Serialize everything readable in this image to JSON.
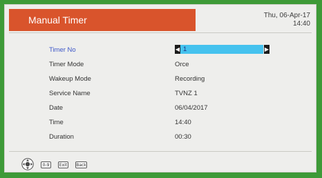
{
  "header": {
    "title": "Manual Timer",
    "date": "Thu, 06-Apr-17",
    "time": "14:40"
  },
  "fields": [
    {
      "label": "Timer No",
      "value": "1"
    },
    {
      "label": "Timer Mode",
      "value": "Orce"
    },
    {
      "label": "Wakeup Mode",
      "value": "Recording"
    },
    {
      "label": "Service Name",
      "value": "TVNZ 1"
    },
    {
      "label": "Date",
      "value": "06/04/2017"
    },
    {
      "label": "Time",
      "value": "14:40"
    },
    {
      "label": "Duration",
      "value": "00:30"
    }
  ],
  "footer": {
    "keys": [
      "0-9",
      "Exit",
      "Back"
    ]
  },
  "colors": {
    "title_bar": "#d9542c",
    "selection": "#45c2ee",
    "frame": "#3e9a38"
  }
}
